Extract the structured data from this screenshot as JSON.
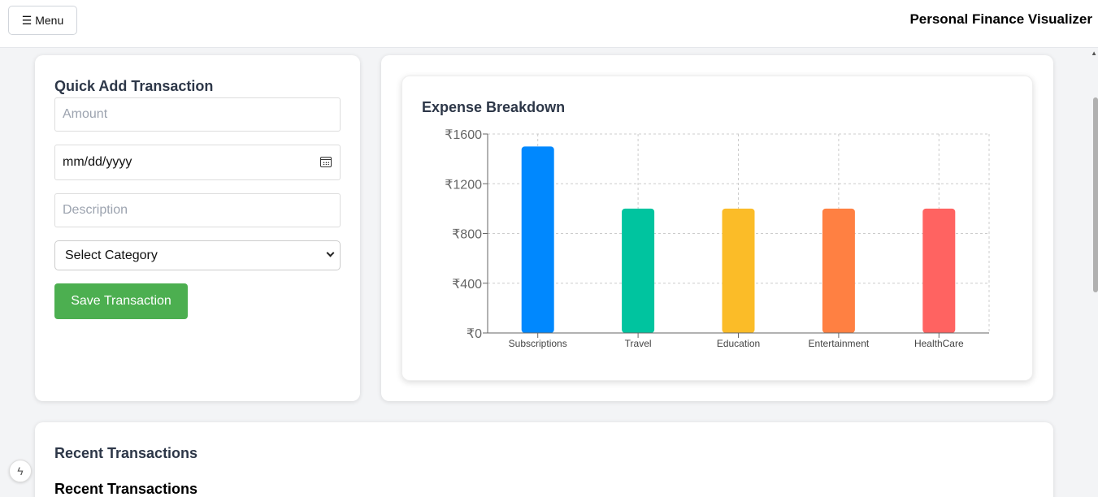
{
  "header": {
    "menu_label": "☰ Menu",
    "app_title": "Personal Finance Visualizer"
  },
  "quick_add": {
    "title": "Quick Add Transaction",
    "amount_placeholder": "Amount",
    "date_value": "mm/dd/yyyy",
    "description_placeholder": "Description",
    "category_selected": "Select Category",
    "save_label": "Save Transaction"
  },
  "expense_chart": {
    "title": "Expense Breakdown"
  },
  "recent": {
    "section_title": "Recent Transactions",
    "list_title": "Recent Transactions"
  },
  "chart_data": {
    "type": "bar",
    "title": "Expense Breakdown",
    "categories": [
      "Subscriptions",
      "Travel",
      "Education",
      "Entertainment",
      "HealthCare"
    ],
    "values": [
      1500,
      1000,
      1000,
      1000,
      1000
    ],
    "colors": [
      "#0088fe",
      "#00c49f",
      "#fbbc28",
      "#ff8042",
      "#ff6361"
    ],
    "yticks": [
      "₹0",
      "₹400",
      "₹800",
      "₹1200",
      "₹1600"
    ],
    "ylim": [
      0,
      1600
    ],
    "grid": true,
    "xlabel": "",
    "ylabel": ""
  }
}
